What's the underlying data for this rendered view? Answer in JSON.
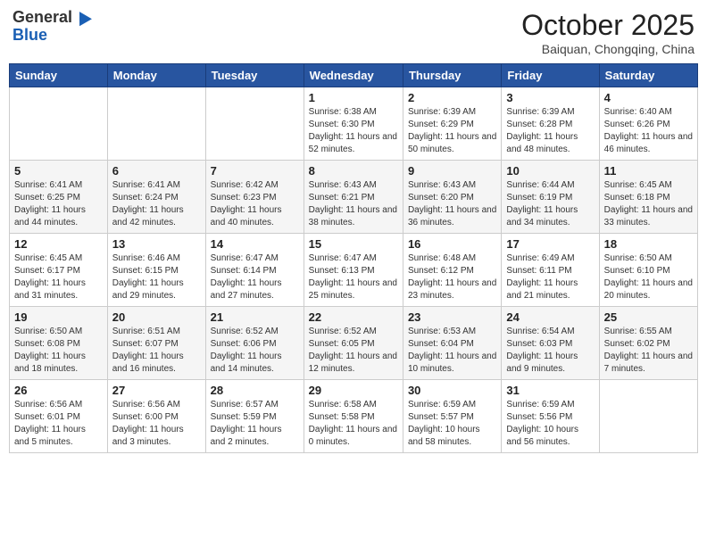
{
  "header": {
    "logo_general": "General",
    "logo_blue": "Blue",
    "month_title": "October 2025",
    "subtitle": "Baiquan, Chongqing, China"
  },
  "weekdays": [
    "Sunday",
    "Monday",
    "Tuesday",
    "Wednesday",
    "Thursday",
    "Friday",
    "Saturday"
  ],
  "weeks": [
    [
      {
        "day": "",
        "info": ""
      },
      {
        "day": "",
        "info": ""
      },
      {
        "day": "",
        "info": ""
      },
      {
        "day": "1",
        "info": "Sunrise: 6:38 AM\nSunset: 6:30 PM\nDaylight: 11 hours and 52 minutes."
      },
      {
        "day": "2",
        "info": "Sunrise: 6:39 AM\nSunset: 6:29 PM\nDaylight: 11 hours and 50 minutes."
      },
      {
        "day": "3",
        "info": "Sunrise: 6:39 AM\nSunset: 6:28 PM\nDaylight: 11 hours and 48 minutes."
      },
      {
        "day": "4",
        "info": "Sunrise: 6:40 AM\nSunset: 6:26 PM\nDaylight: 11 hours and 46 minutes."
      }
    ],
    [
      {
        "day": "5",
        "info": "Sunrise: 6:41 AM\nSunset: 6:25 PM\nDaylight: 11 hours and 44 minutes."
      },
      {
        "day": "6",
        "info": "Sunrise: 6:41 AM\nSunset: 6:24 PM\nDaylight: 11 hours and 42 minutes."
      },
      {
        "day": "7",
        "info": "Sunrise: 6:42 AM\nSunset: 6:23 PM\nDaylight: 11 hours and 40 minutes."
      },
      {
        "day": "8",
        "info": "Sunrise: 6:43 AM\nSunset: 6:21 PM\nDaylight: 11 hours and 38 minutes."
      },
      {
        "day": "9",
        "info": "Sunrise: 6:43 AM\nSunset: 6:20 PM\nDaylight: 11 hours and 36 minutes."
      },
      {
        "day": "10",
        "info": "Sunrise: 6:44 AM\nSunset: 6:19 PM\nDaylight: 11 hours and 34 minutes."
      },
      {
        "day": "11",
        "info": "Sunrise: 6:45 AM\nSunset: 6:18 PM\nDaylight: 11 hours and 33 minutes."
      }
    ],
    [
      {
        "day": "12",
        "info": "Sunrise: 6:45 AM\nSunset: 6:17 PM\nDaylight: 11 hours and 31 minutes."
      },
      {
        "day": "13",
        "info": "Sunrise: 6:46 AM\nSunset: 6:15 PM\nDaylight: 11 hours and 29 minutes."
      },
      {
        "day": "14",
        "info": "Sunrise: 6:47 AM\nSunset: 6:14 PM\nDaylight: 11 hours and 27 minutes."
      },
      {
        "day": "15",
        "info": "Sunrise: 6:47 AM\nSunset: 6:13 PM\nDaylight: 11 hours and 25 minutes."
      },
      {
        "day": "16",
        "info": "Sunrise: 6:48 AM\nSunset: 6:12 PM\nDaylight: 11 hours and 23 minutes."
      },
      {
        "day": "17",
        "info": "Sunrise: 6:49 AM\nSunset: 6:11 PM\nDaylight: 11 hours and 21 minutes."
      },
      {
        "day": "18",
        "info": "Sunrise: 6:50 AM\nSunset: 6:10 PM\nDaylight: 11 hours and 20 minutes."
      }
    ],
    [
      {
        "day": "19",
        "info": "Sunrise: 6:50 AM\nSunset: 6:08 PM\nDaylight: 11 hours and 18 minutes."
      },
      {
        "day": "20",
        "info": "Sunrise: 6:51 AM\nSunset: 6:07 PM\nDaylight: 11 hours and 16 minutes."
      },
      {
        "day": "21",
        "info": "Sunrise: 6:52 AM\nSunset: 6:06 PM\nDaylight: 11 hours and 14 minutes."
      },
      {
        "day": "22",
        "info": "Sunrise: 6:52 AM\nSunset: 6:05 PM\nDaylight: 11 hours and 12 minutes."
      },
      {
        "day": "23",
        "info": "Sunrise: 6:53 AM\nSunset: 6:04 PM\nDaylight: 11 hours and 10 minutes."
      },
      {
        "day": "24",
        "info": "Sunrise: 6:54 AM\nSunset: 6:03 PM\nDaylight: 11 hours and 9 minutes."
      },
      {
        "day": "25",
        "info": "Sunrise: 6:55 AM\nSunset: 6:02 PM\nDaylight: 11 hours and 7 minutes."
      }
    ],
    [
      {
        "day": "26",
        "info": "Sunrise: 6:56 AM\nSunset: 6:01 PM\nDaylight: 11 hours and 5 minutes."
      },
      {
        "day": "27",
        "info": "Sunrise: 6:56 AM\nSunset: 6:00 PM\nDaylight: 11 hours and 3 minutes."
      },
      {
        "day": "28",
        "info": "Sunrise: 6:57 AM\nSunset: 5:59 PM\nDaylight: 11 hours and 2 minutes."
      },
      {
        "day": "29",
        "info": "Sunrise: 6:58 AM\nSunset: 5:58 PM\nDaylight: 11 hours and 0 minutes."
      },
      {
        "day": "30",
        "info": "Sunrise: 6:59 AM\nSunset: 5:57 PM\nDaylight: 10 hours and 58 minutes."
      },
      {
        "day": "31",
        "info": "Sunrise: 6:59 AM\nSunset: 5:56 PM\nDaylight: 10 hours and 56 minutes."
      },
      {
        "day": "",
        "info": ""
      }
    ]
  ]
}
